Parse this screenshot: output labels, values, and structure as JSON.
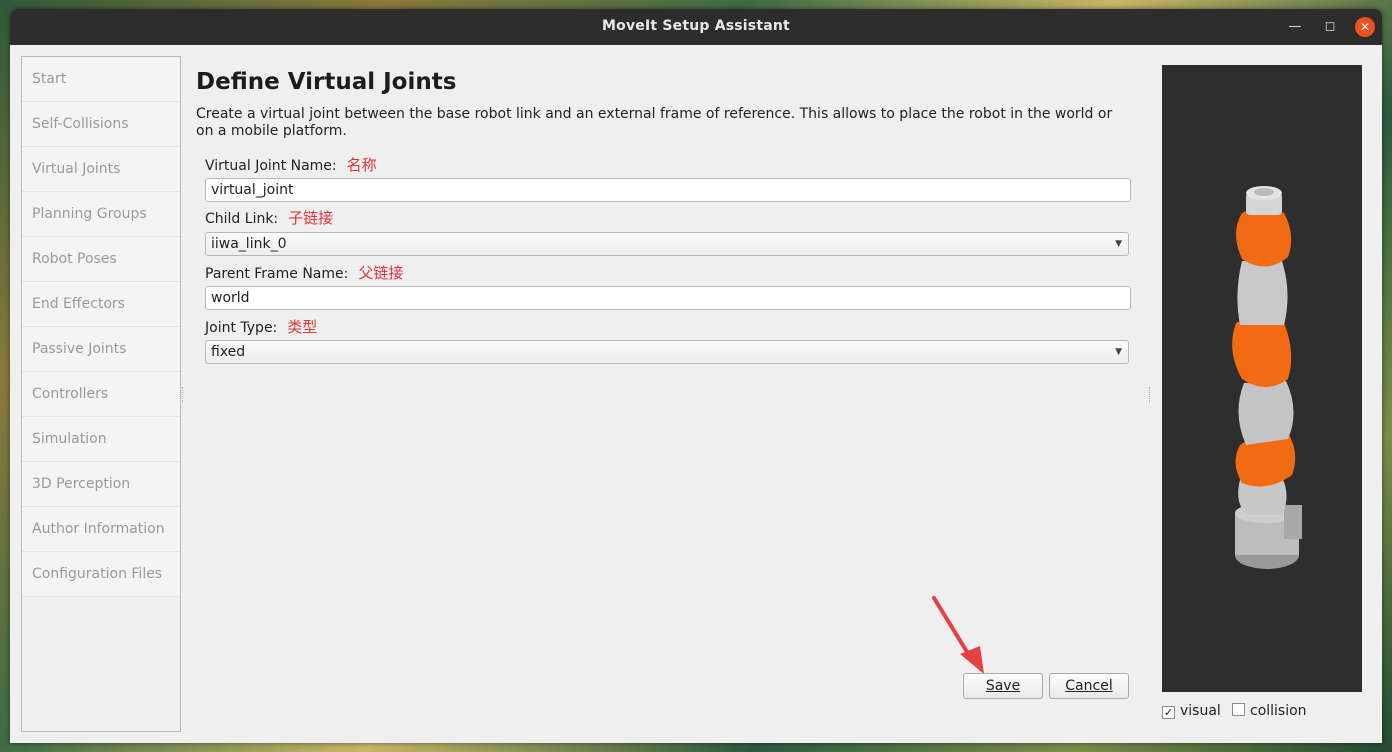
{
  "window": {
    "title": "MoveIt Setup Assistant"
  },
  "sidebar": {
    "items": [
      {
        "label": "Start"
      },
      {
        "label": "Self-Collisions"
      },
      {
        "label": "Virtual Joints"
      },
      {
        "label": "Planning Groups"
      },
      {
        "label": "Robot Poses"
      },
      {
        "label": "End Effectors"
      },
      {
        "label": "Passive Joints"
      },
      {
        "label": "Controllers"
      },
      {
        "label": "Simulation"
      },
      {
        "label": "3D Perception"
      },
      {
        "label": "Author Information"
      },
      {
        "label": "Configuration Files"
      }
    ]
  },
  "main": {
    "title": "Define Virtual Joints",
    "description": "Create a virtual joint between the base robot link and an external frame of reference. This allows to place the robot in the world or on a mobile platform.",
    "fields": {
      "joint_name": {
        "label": "Virtual Joint Name:",
        "annotation": "名称",
        "value": "virtual_joint"
      },
      "child_link": {
        "label": "Child Link:",
        "annotation": "子链接",
        "value": "iiwa_link_0"
      },
      "parent_frame": {
        "label": "Parent Frame Name:",
        "annotation": "父链接",
        "value": "world"
      },
      "joint_type": {
        "label": "Joint Type:",
        "annotation": "类型",
        "value": "fixed"
      }
    },
    "buttons": {
      "save": "Save",
      "cancel": "Cancel"
    }
  },
  "viewer": {
    "visual_label": "visual",
    "visual_checked": true,
    "collision_label": "collision",
    "collision_checked": false
  },
  "colors": {
    "annotation": "#e2343c",
    "robot_accent": "#f26b12",
    "titlebar": "#2d2d2d"
  }
}
